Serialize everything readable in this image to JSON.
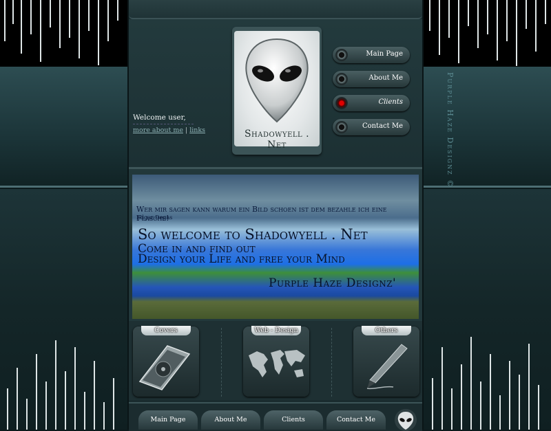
{
  "welcome": {
    "greeting": "Welcome user,",
    "link_about": "more about me",
    "link_sep": "|",
    "link_links": "links"
  },
  "logo": {
    "text": "Shadowyell . Net",
    "icon": "alien-head-icon"
  },
  "nav": [
    {
      "label": "Main Page",
      "active": false
    },
    {
      "label": "About Me",
      "active": false
    },
    {
      "label": "Clients",
      "active": true
    },
    {
      "label": "Contact Me",
      "active": false
    }
  ],
  "banner": {
    "quote": "Wer mir sagen kann warum ein Bild schoen ist dem bezahle ich eine Flasche!",
    "author": "Edgar Degas",
    "title": "So welcome to Shadowyell . Net",
    "line1": "Come in and find out",
    "line2": "Design your Life and free your Mind",
    "signature": "Purple Haze Designz'"
  },
  "categories": [
    {
      "label": "Covers",
      "icon": "cd-case-icon"
    },
    {
      "label": "Web - Design",
      "icon": "world-map-icon"
    },
    {
      "label": "Others",
      "icon": "pen-icon"
    }
  ],
  "footer": [
    {
      "label": "Main Page"
    },
    {
      "label": "About Me"
    },
    {
      "label": "Clients"
    },
    {
      "label": "Contact Me"
    }
  ],
  "side_logo": "Purple Haze Designz ©"
}
